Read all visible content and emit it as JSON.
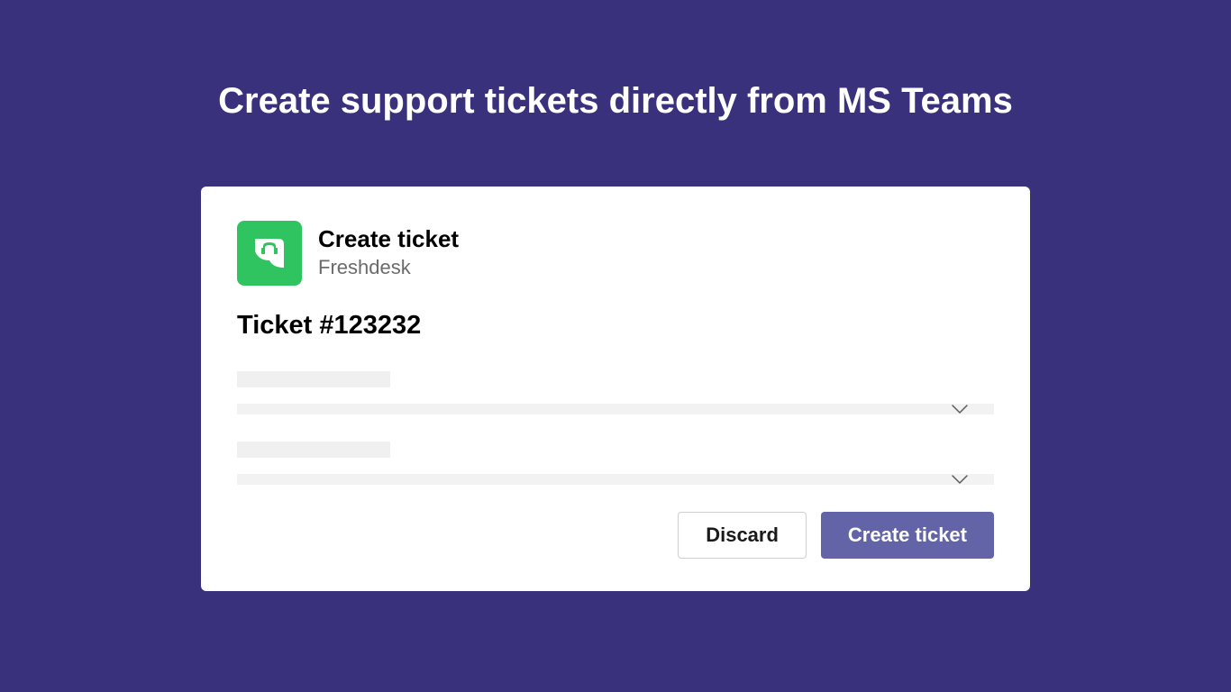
{
  "page": {
    "title": "Create support tickets directly from MS Teams"
  },
  "card": {
    "header": {
      "title": "Create ticket",
      "subtitle": "Freshdesk"
    },
    "ticket_heading": "Ticket #123232",
    "buttons": {
      "discard": "Discard",
      "create": "Create ticket"
    }
  },
  "colors": {
    "background": "#3a317c",
    "card_bg": "#ffffff",
    "icon_bg": "#30c460",
    "primary_button": "#6264a7",
    "placeholder": "#f0f0f0"
  }
}
